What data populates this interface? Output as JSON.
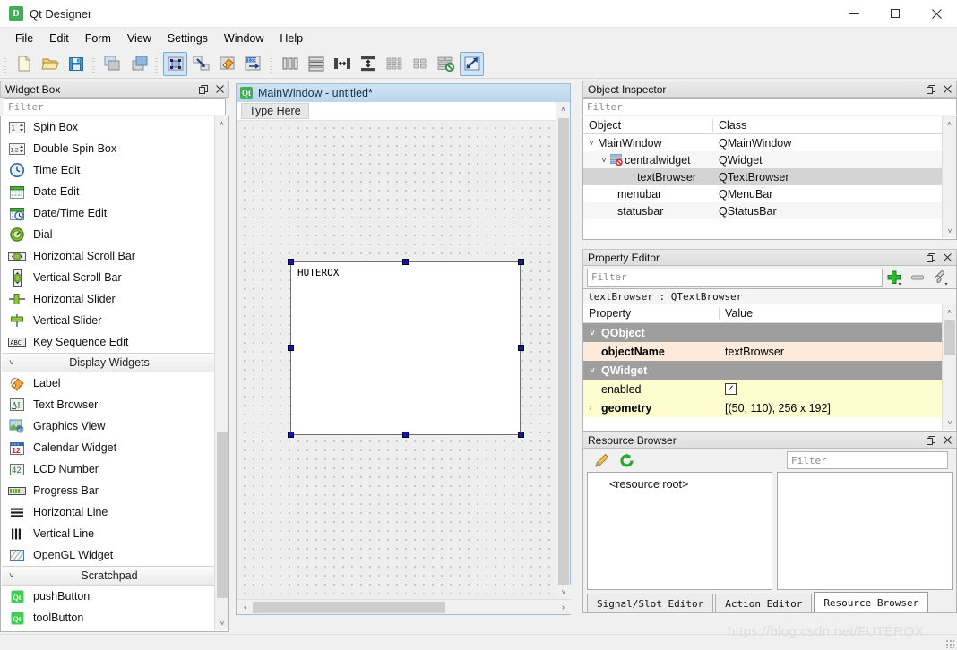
{
  "window": {
    "title": "Qt Designer",
    "app_icon": "qt-designer-icon",
    "minimize_label": "—",
    "maximize_label": "□",
    "close_label": "✕"
  },
  "menubar": {
    "items": [
      {
        "label": "File"
      },
      {
        "label": "Edit"
      },
      {
        "label": "Form"
      },
      {
        "label": "View"
      },
      {
        "label": "Settings"
      },
      {
        "label": "Window"
      },
      {
        "label": "Help"
      }
    ]
  },
  "toolbar": {
    "groups": [
      {
        "items": [
          {
            "name": "new-form-icon",
            "title": "New"
          },
          {
            "name": "open-form-icon",
            "title": "Open"
          },
          {
            "name": "save-form-icon",
            "title": "Save"
          }
        ]
      },
      {
        "items": [
          {
            "name": "undo-icon",
            "title": "Undo"
          },
          {
            "name": "redo-icon",
            "title": "Redo"
          }
        ]
      },
      {
        "items": [
          {
            "name": "edit-widgets-icon",
            "title": "Edit Widgets",
            "active": true
          },
          {
            "name": "edit-signals-slots-icon",
            "title": "Edit Signals/Slots"
          },
          {
            "name": "edit-buddies-icon",
            "title": "Edit Buddies"
          },
          {
            "name": "edit-tab-order-icon",
            "title": "Edit Tab Order"
          }
        ]
      },
      {
        "items": [
          {
            "name": "layout-horizontally-icon",
            "title": "Lay Out Horizontally"
          },
          {
            "name": "layout-vertically-icon",
            "title": "Lay Out Vertically"
          },
          {
            "name": "layout-splitter-horizontal-icon",
            "title": "Lay Out Horizontally in Splitter"
          },
          {
            "name": "layout-splitter-vertical-icon",
            "title": "Lay Out Vertically in Splitter"
          },
          {
            "name": "layout-form-icon",
            "title": "Lay Out in a Form Layout"
          },
          {
            "name": "layout-grid-icon",
            "title": "Lay Out in a Grid"
          },
          {
            "name": "break-layout-icon",
            "title": "Break Layout"
          },
          {
            "name": "adjust-size-icon",
            "title": "Adjust Size",
            "active": true
          }
        ]
      }
    ]
  },
  "widget_box": {
    "title": "Widget Box",
    "filter_placeholder": "Filter",
    "filter_value": "",
    "undock_label": "❐",
    "close_label": "✕",
    "items": [
      {
        "type": "widget",
        "label": "Spin Box",
        "icon": "spinbox-icon"
      },
      {
        "type": "widget",
        "label": "Double Spin Box",
        "icon": "double-spinbox-icon"
      },
      {
        "type": "widget",
        "label": "Time Edit",
        "icon": "time-edit-icon"
      },
      {
        "type": "widget",
        "label": "Date Edit",
        "icon": "date-edit-icon"
      },
      {
        "type": "widget",
        "label": "Date/Time Edit",
        "icon": "datetime-edit-icon"
      },
      {
        "type": "widget",
        "label": "Dial",
        "icon": "dial-icon"
      },
      {
        "type": "widget",
        "label": "Horizontal Scroll Bar",
        "icon": "hscrollbar-icon"
      },
      {
        "type": "widget",
        "label": "Vertical Scroll Bar",
        "icon": "vscrollbar-icon"
      },
      {
        "type": "widget",
        "label": "Horizontal Slider",
        "icon": "hslider-icon"
      },
      {
        "type": "widget",
        "label": "Vertical Slider",
        "icon": "vslider-icon"
      },
      {
        "type": "widget",
        "label": "Key Sequence Edit",
        "icon": "key-sequence-icon"
      },
      {
        "type": "category",
        "label": "Display Widgets",
        "expanded": true
      },
      {
        "type": "widget",
        "label": "Label",
        "icon": "label-icon"
      },
      {
        "type": "widget",
        "label": "Text Browser",
        "icon": "text-browser-icon"
      },
      {
        "type": "widget",
        "label": "Graphics View",
        "icon": "graphics-view-icon"
      },
      {
        "type": "widget",
        "label": "Calendar Widget",
        "icon": "calendar-widget-icon"
      },
      {
        "type": "widget",
        "label": "LCD Number",
        "icon": "lcd-number-icon"
      },
      {
        "type": "widget",
        "label": "Progress Bar",
        "icon": "progress-bar-icon"
      },
      {
        "type": "widget",
        "label": "Horizontal Line",
        "icon": "hline-icon"
      },
      {
        "type": "widget",
        "label": "Vertical Line",
        "icon": "vline-icon"
      },
      {
        "type": "widget",
        "label": "OpenGL Widget",
        "icon": "opengl-widget-icon"
      },
      {
        "type": "category",
        "label": "Scratchpad",
        "expanded": true
      },
      {
        "type": "widget",
        "label": "pushButton",
        "icon": "qt-scratch-icon"
      },
      {
        "type": "widget",
        "label": "toolButton",
        "icon": "qt-scratch-icon"
      }
    ]
  },
  "form_editor": {
    "window_title": "MainWindow - untitled*",
    "window_icon": "qt-icon",
    "menu_placeholder": "Type Here",
    "text_browser_content": "HUTEROX",
    "scroll_up_label": "⌃",
    "scroll_down_label": "⌄",
    "scroll_left_label": "‹",
    "scroll_right_label": "›"
  },
  "object_inspector": {
    "title": "Object Inspector",
    "filter_placeholder": "Filter",
    "filter_value": "",
    "undock_label": "❐",
    "close_label": "✕",
    "columns": [
      "Object",
      "Class"
    ],
    "rows": [
      {
        "object": "MainWindow",
        "class": "QMainWindow",
        "depth": 0,
        "expander": "˅",
        "icon": "",
        "selected": false
      },
      {
        "object": "centralwidget",
        "class": "QWidget",
        "depth": 1,
        "expander": "˅",
        "icon": "no-layout-icon",
        "selected": false
      },
      {
        "object": "textBrowser",
        "class": "QTextBrowser",
        "depth": 2,
        "expander": "",
        "icon": "",
        "selected": true
      },
      {
        "object": "menubar",
        "class": "QMenuBar",
        "depth": 1,
        "expander": "",
        "icon": "",
        "selected": false
      },
      {
        "object": "statusbar",
        "class": "QStatusBar",
        "depth": 1,
        "expander": "",
        "icon": "",
        "selected": false
      }
    ]
  },
  "property_editor": {
    "title": "Property Editor",
    "filter_placeholder": "Filter",
    "filter_value": "",
    "undock_label": "❐",
    "close_label": "✕",
    "add_label": "add-dynamic-property-icon",
    "remove_label": "remove-dynamic-property-icon",
    "configure_label": "configure-property-editor-icon",
    "object_line": "textBrowser : QTextBrowser",
    "columns": [
      "Property",
      "Value"
    ],
    "rows": [
      {
        "kind": "group",
        "property": "QObject",
        "value": "",
        "expander": "˅"
      },
      {
        "kind": "prop",
        "property": "objectName",
        "value": "textBrowser",
        "style": "peach",
        "bold": true,
        "expander": ""
      },
      {
        "kind": "group",
        "property": "QWidget",
        "value": "",
        "expander": "˅"
      },
      {
        "kind": "prop",
        "property": "enabled",
        "value": "",
        "style": "yellow",
        "bold": false,
        "expander": "",
        "checkbox": true,
        "checked": true
      },
      {
        "kind": "prop",
        "property": "geometry",
        "value": "[(50, 110), 256 x 192]",
        "style": "yellow",
        "bold": true,
        "expander": "›"
      }
    ]
  },
  "resource_browser": {
    "title": "Resource Browser",
    "undock_label": "❐",
    "close_label": "✕",
    "edit_icon": "edit-resources-icon",
    "reload_icon": "reload-resources-icon",
    "filter_placeholder": "Filter",
    "filter_value": "",
    "tree_root": "<resource root>",
    "tabs": [
      {
        "label": "Signal/Slot Editor",
        "active": false
      },
      {
        "label": "Action Editor",
        "active": false
      },
      {
        "label": "Resource Browser",
        "active": true
      }
    ]
  },
  "watermark": "https://blog.csdn.net/FUTEROX",
  "colors": {
    "window_bg": "#f0f0f0",
    "panel_header": "#e4e4e4",
    "selection": "#d4d4d4",
    "group_row": "#9e9e9e",
    "peach_row": "#fdeadb",
    "yellow_row": "#fdfdcf",
    "mdi_title": "#b9d6ed",
    "handle": "#1414b4",
    "qt_green": "#3fae55"
  }
}
